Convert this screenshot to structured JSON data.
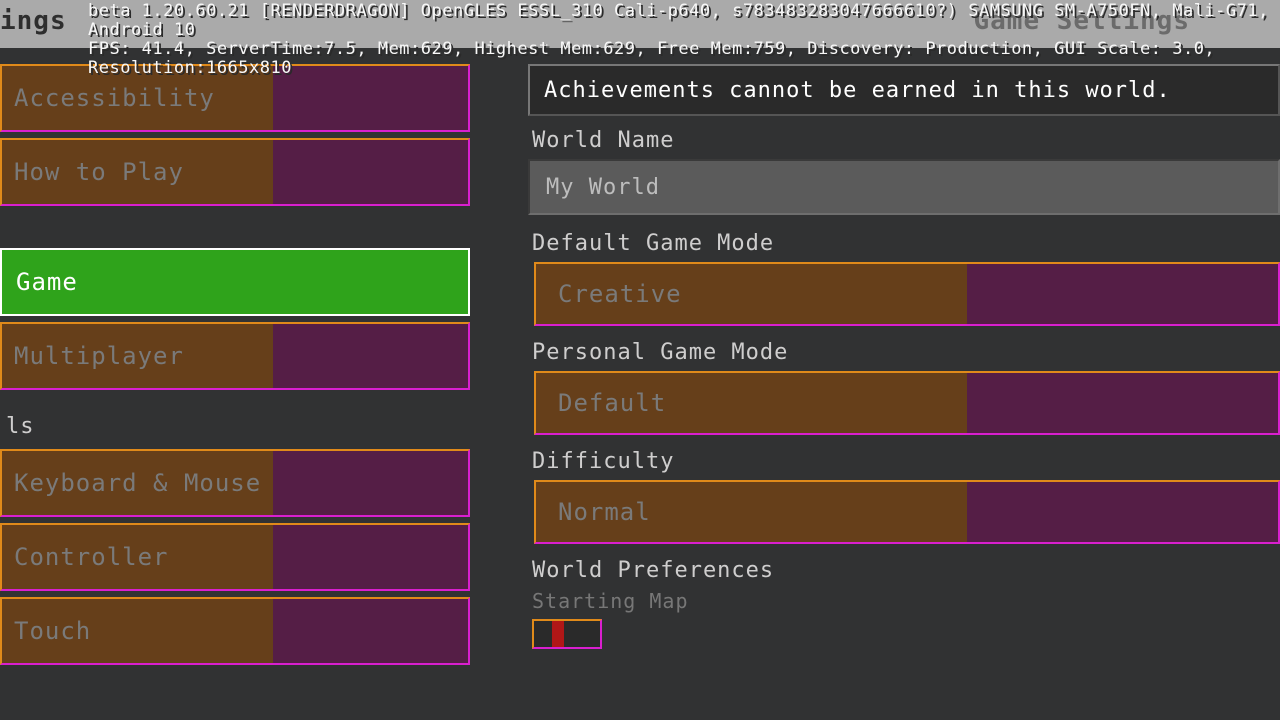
{
  "debug": {
    "line1": "beta 1.20.60.21 [RENDERDRAGON] OpenGLES ESSL_310 Cali-p640, s783483283047666610?) SAMSUNG SM-A750FN, Mali-G71, Android 10",
    "line2": "FPS: 41.4, ServerTime:7.5, Mem:629, Highest Mem:629, Free Mem:759, Discovery: Production, GUI Scale: 3.0, Resolution:1665x810"
  },
  "header": {
    "left": "ings",
    "right": "Game Settings"
  },
  "sidebar": {
    "section_controls": "ls",
    "items": [
      {
        "label": "Accessibility"
      },
      {
        "label": "How to Play"
      },
      {
        "label": "Game"
      },
      {
        "label": "Multiplayer"
      },
      {
        "label": "Keyboard & Mouse"
      },
      {
        "label": "Controller"
      },
      {
        "label": "Touch"
      }
    ]
  },
  "main": {
    "banner": "Achievements cannot be earned in this world.",
    "world_name_label": "World Name",
    "world_name_value": "My World",
    "default_mode_label": "Default Game Mode",
    "default_mode_value": "Creative",
    "personal_mode_label": "Personal Game Mode",
    "personal_mode_value": "Default",
    "difficulty_label": "Difficulty",
    "difficulty_value": "Normal",
    "preferences_label": "World Preferences",
    "starting_map_label": "Starting Map"
  }
}
